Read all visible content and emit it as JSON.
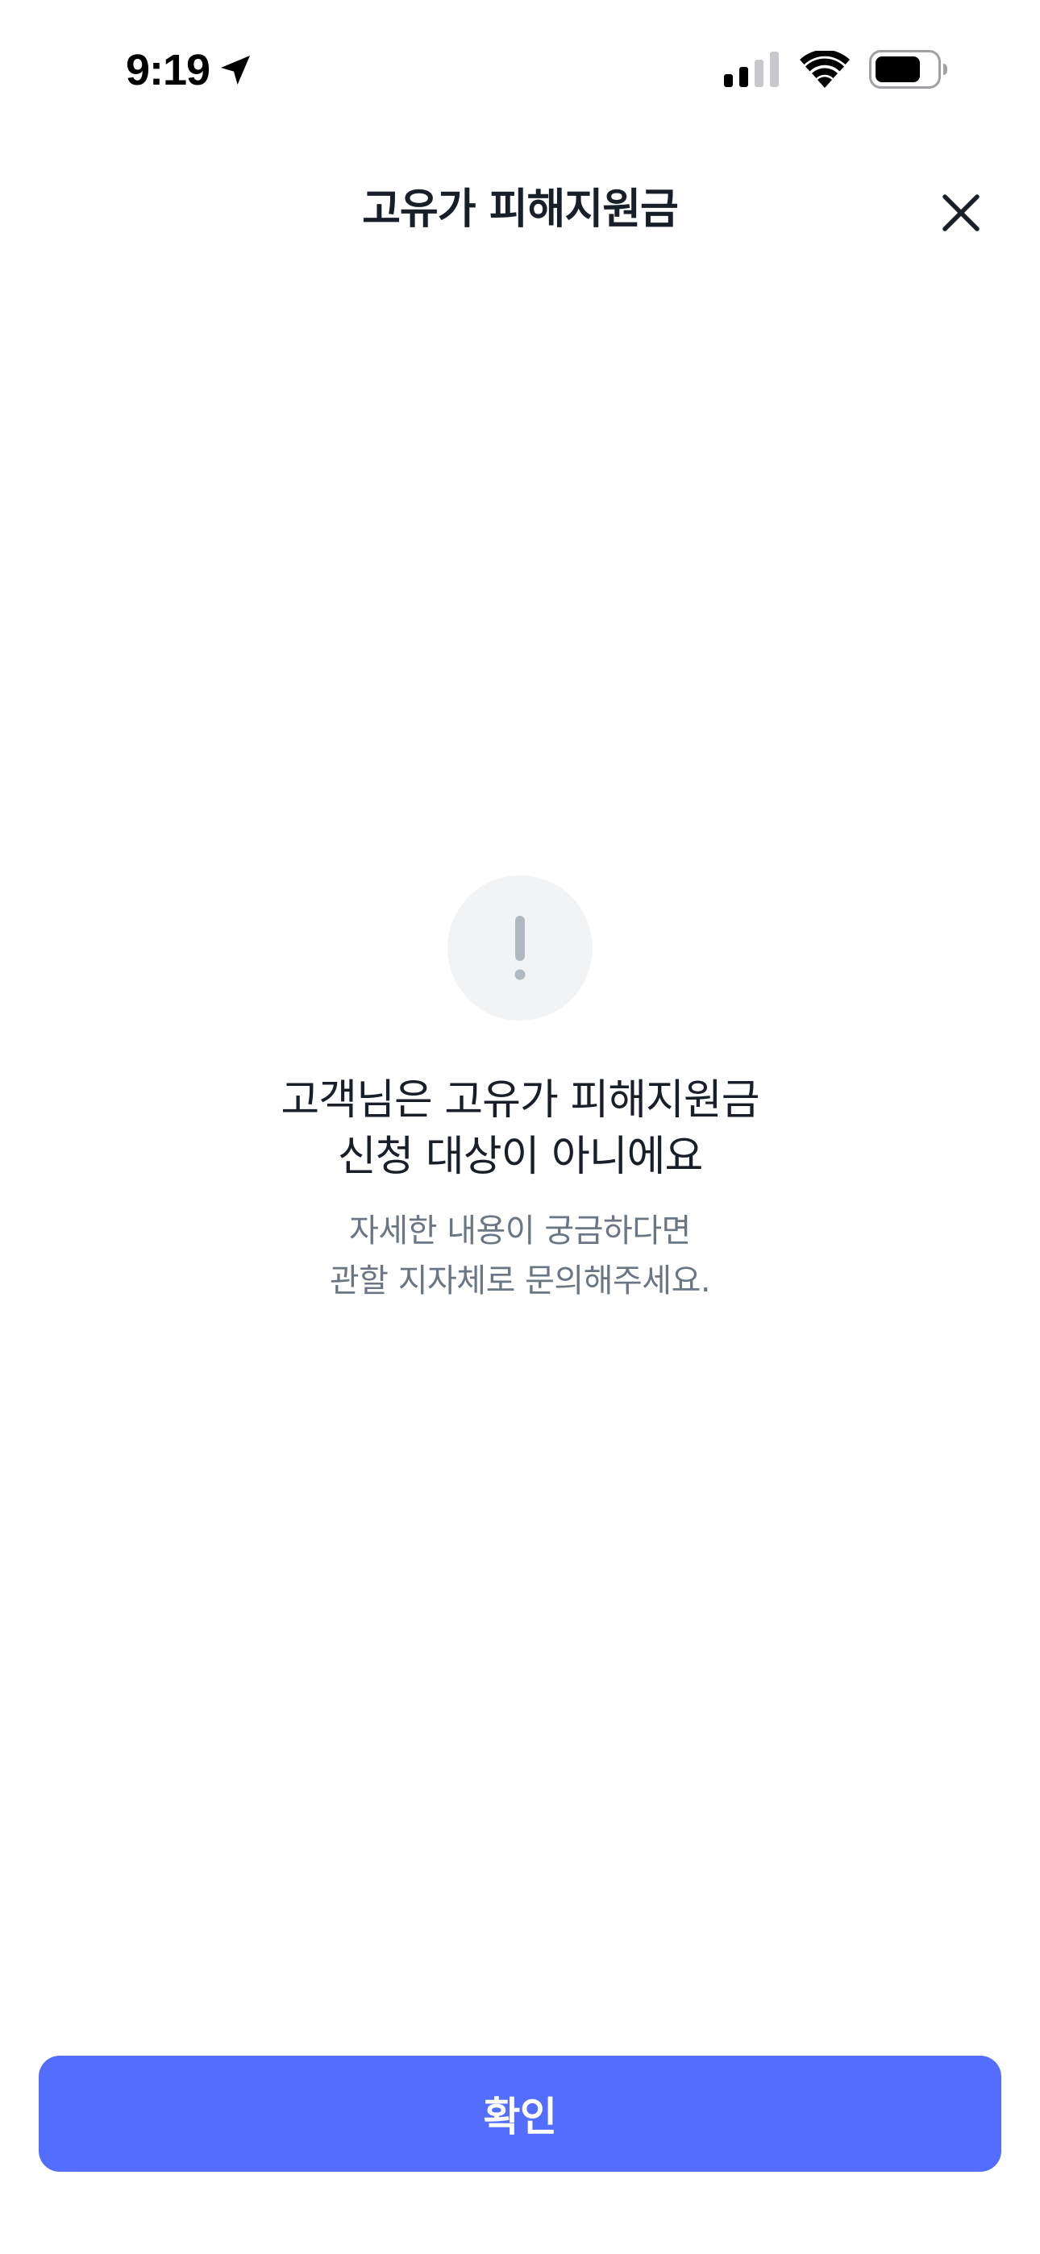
{
  "status_bar": {
    "time": "9:19",
    "icons": [
      "location-arrow-icon",
      "cellular-signal-icon",
      "wifi-icon",
      "battery-icon"
    ]
  },
  "header": {
    "title": "고유가 피해지원금",
    "close_icon": "close-icon"
  },
  "result": {
    "icon": "exclamation-icon",
    "title_line1": "고객님은 고유가 피해지원금",
    "title_line2": "신청 대상이 아니에요",
    "desc_line1": "자세한 내용이 궁금하다면",
    "desc_line2": "관할 지자체로 문의해주세요."
  },
  "footer": {
    "confirm_label": "확인"
  },
  "colors": {
    "accent": "#536dfe",
    "title_text": "#191f28",
    "desc_text": "#6b7684",
    "alert_circle_bg": "#f2f3f5",
    "alert_icon": "#b0b8c1"
  }
}
